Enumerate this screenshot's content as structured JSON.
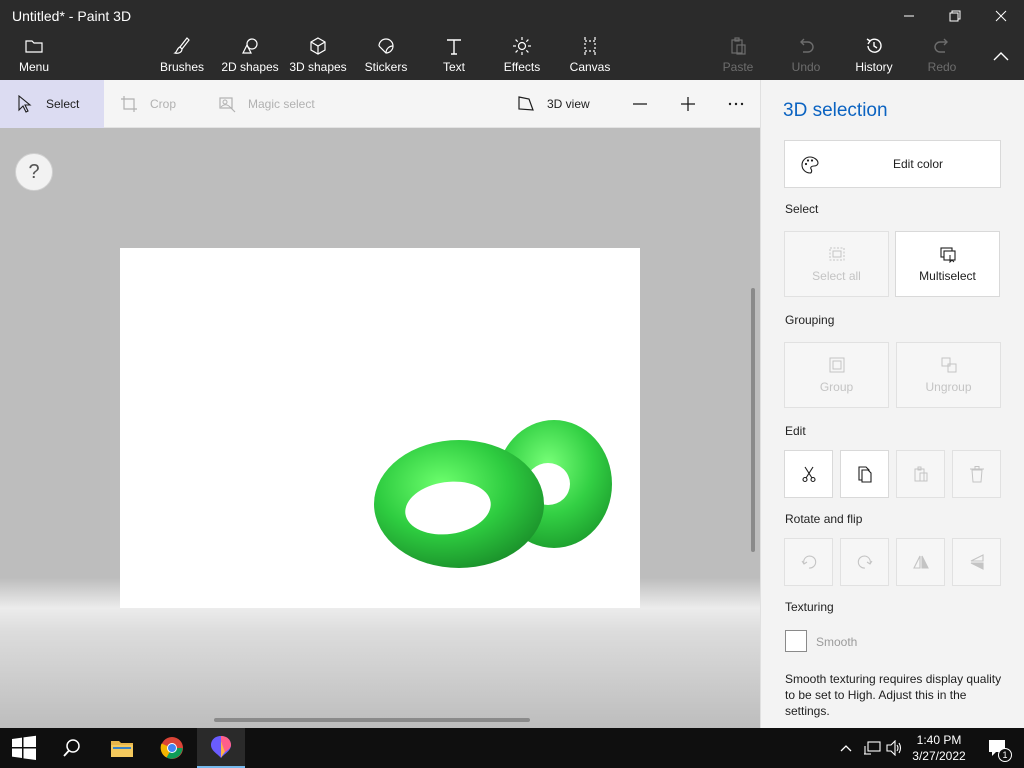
{
  "window": {
    "title": "Untitled* - Paint 3D"
  },
  "ribbon": {
    "menu_label": "Menu",
    "tabs": [
      {
        "label": "Brushes",
        "icon": "brush-icon"
      },
      {
        "label": "2D shapes",
        "icon": "2d-shapes-icon"
      },
      {
        "label": "3D shapes",
        "icon": "3d-shapes-icon"
      },
      {
        "label": "Stickers",
        "icon": "stickers-icon"
      },
      {
        "label": "Text",
        "icon": "text-icon"
      },
      {
        "label": "Effects",
        "icon": "effects-icon"
      },
      {
        "label": "Canvas",
        "icon": "canvas-icon"
      }
    ],
    "paste_label": "Paste",
    "undo_label": "Undo",
    "history_label": "History",
    "redo_label": "Redo"
  },
  "toolbar": {
    "select_label": "Select",
    "crop_label": "Crop",
    "magic_select_label": "Magic select",
    "view_3d_label": "3D view"
  },
  "workspace": {
    "help_label": "?"
  },
  "panel": {
    "title": "3D selection",
    "edit_color_label": "Edit color",
    "select_section": "Select",
    "select_all_label": "Select all",
    "multiselect_label": "Multiselect",
    "grouping_section": "Grouping",
    "group_label": "Group",
    "ungroup_label": "Ungroup",
    "edit_section": "Edit",
    "rotate_section": "Rotate and flip",
    "texturing_section": "Texturing",
    "smooth_label": "Smooth",
    "smooth_note": "Smooth texturing requires display quality to be set to High. Adjust this in the settings."
  },
  "taskbar": {
    "time": "1:40 PM",
    "date": "3/27/2022",
    "notification_count": "1"
  },
  "colors": {
    "accent": "#0b63c1",
    "torus_green": "#2ecc40"
  }
}
